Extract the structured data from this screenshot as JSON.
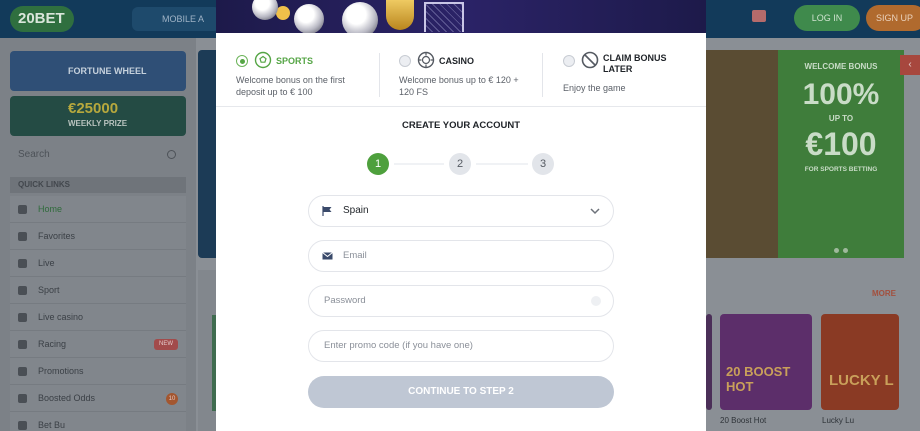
{
  "background": {
    "header": {
      "logo": "20BET",
      "mobile_label": "MOBILE A",
      "login_label": "LOG IN",
      "signup_label": "SIGN UP"
    },
    "sidebar": {
      "promo_wheel": "FORTUNE WHEEL",
      "promo_prize_amount": "€25000",
      "promo_prize_label": "WEEKLY PRIZE",
      "search_placeholder": "Search",
      "quick_links_label": "QUICK LINKS",
      "items": [
        {
          "label": "Home",
          "icon": "home-icon"
        },
        {
          "label": "Favorites",
          "icon": "star-icon"
        },
        {
          "label": "Live",
          "icon": "live-icon"
        },
        {
          "label": "Sport",
          "icon": "sport-icon"
        },
        {
          "label": "Live casino",
          "icon": "card-icon"
        },
        {
          "label": "Racing",
          "icon": "horse-icon",
          "badge": "NEW"
        },
        {
          "label": "Promotions",
          "icon": "gift-icon"
        },
        {
          "label": "Boosted Odds",
          "icon": "boost-icon",
          "badge": "10"
        },
        {
          "label": "Bet Bu",
          "icon": "bet-icon"
        }
      ]
    },
    "welcome_card": {
      "title": "WELCOME BONUS",
      "percent": "100%",
      "up_to": "UP TO",
      "amount": "€100",
      "subtitle": "FOR SPORTS BETTING"
    },
    "more_label": "MORE",
    "games": [
      {
        "art_text": "20 BOOST HOT",
        "caption": "20 Boost Hot"
      },
      {
        "art_text": "LUCKY L",
        "caption": "Lucky Lu"
      }
    ]
  },
  "modal": {
    "bonus_options": [
      {
        "title": "SPORTS",
        "description": "Welcome bonus on the first deposit up to € 100",
        "icon": "soccer-ball-icon",
        "selected": true
      },
      {
        "title": "CASINO",
        "description": "Welcome bonus up to € 120 + 120 FS",
        "icon": "casino-chip-icon",
        "selected": false
      },
      {
        "title": "CLAIM BONUS LATER",
        "description": "Enjoy the game",
        "icon": "no-bonus-icon",
        "selected": false
      }
    ],
    "create_title": "CREATE YOUR ACCOUNT",
    "steps": [
      "1",
      "2",
      "3"
    ],
    "active_step": 1,
    "country_value": "Spain",
    "email_placeholder": "Email",
    "password_placeholder": "Password",
    "promo_placeholder": "Enter promo code (if you have one)",
    "continue_label": "CONTINUE TO STEP 2",
    "colors": {
      "accent_green": "#4ea03d",
      "button_disabled": "#bfc7d4"
    }
  }
}
